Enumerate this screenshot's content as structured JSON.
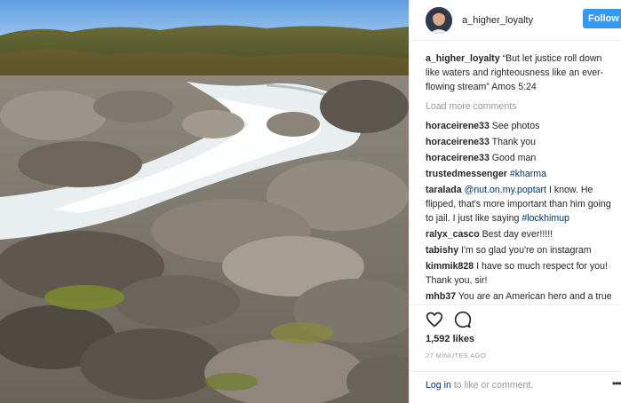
{
  "post": {
    "username": "a_higher_loyalty",
    "follow_label": "Follow",
    "caption_user": "a_higher_loyalty",
    "caption_text": "“But let justice roll down like waters and righteousness like an ever-flowing stream” Amos 5:24",
    "load_more": "Load more comments",
    "likes": "1,592 likes",
    "timestamp": "27 MINUTES AGO",
    "login_link": "Log in",
    "login_suffix": " to like or comment.",
    "more_icon": "•••"
  },
  "comments": [
    {
      "user": "horaceirene33",
      "text": " See photos"
    },
    {
      "user": "horaceirene33",
      "text": " Thank you"
    },
    {
      "user": "horaceirene33",
      "text": " Good man"
    },
    {
      "user": "trustedmessenger",
      "text": " ",
      "mention": "#kharma"
    },
    {
      "user": "taralada",
      "text_before": " ",
      "mention": "@nut.on.my.poptart",
      "text": " I know. He flipped, that's more important than him going to jail. I just like saying ",
      "mention2": "#lockhimup"
    },
    {
      "user": "ralyx_casco",
      "text": " Best day ever!!!!!"
    },
    {
      "user": "tabishy",
      "text": " I'm so glad you're on instagram"
    },
    {
      "user": "kimmik828",
      "text": " I have so much respect for you! Thank you, sir!"
    },
    {
      "user": "mhb37",
      "text": " You are an American hero and a true patriot, history will remember you as"
    }
  ],
  "icons": {
    "heart": "heart-icon",
    "comment": "comment-icon",
    "more": "more-options-icon"
  },
  "colors": {
    "follow_button": "#3897f0",
    "link": "#003569",
    "muted": "#999999",
    "text": "#262626"
  }
}
